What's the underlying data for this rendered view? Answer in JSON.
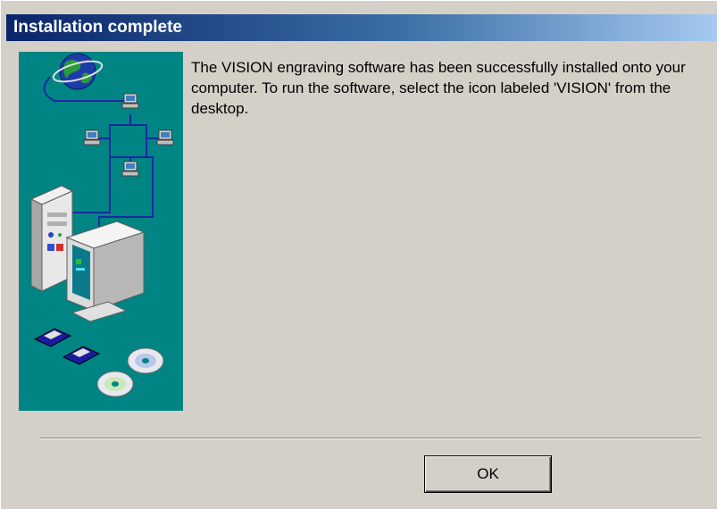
{
  "window": {
    "title": "Installation complete"
  },
  "message": {
    "text": "The VISION engraving software has been successfully installed onto your computer. To run the software, select the icon labeled 'VISION' from the desktop."
  },
  "buttons": {
    "ok_label": "OK"
  },
  "illustration": {
    "background_color": "#008484",
    "icons": [
      "globe-icon",
      "network-computer-icon",
      "desktop-computer-icon",
      "floppy-disk-icon",
      "cd-disc-icon"
    ]
  },
  "colors": {
    "dialog_bg": "#d4d0c8",
    "titlebar_start": "#0a246a",
    "titlebar_end": "#a6caf0"
  }
}
